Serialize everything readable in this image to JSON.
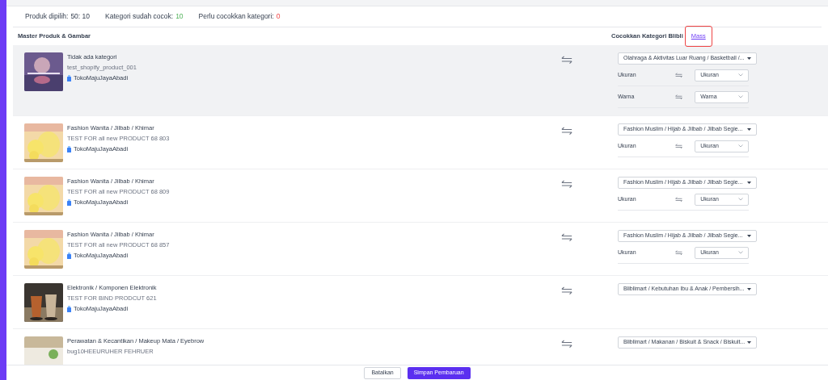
{
  "summary": [
    {
      "label": "Produk dipilih:",
      "value": "50: 10",
      "kind": "total"
    },
    {
      "label": "Kategori sudah cocok:",
      "value": "10",
      "kind": "ok"
    },
    {
      "label": "Perlu cocokkan kategori:",
      "value": "0",
      "kind": "error"
    }
  ],
  "columns": {
    "product": "Master Produk & Gambar",
    "category": "Cocokkan Kategori Blibli",
    "mass_link": "Mass"
  },
  "rows": [
    {
      "selected": true,
      "category": "Tidak ada kategori",
      "name": "test_shopify_product_001",
      "store": "TokoMajuJayaAbadi",
      "target": "Olahraga & Aktivitas Luar Ruang / Basketball /...",
      "attributes": [
        {
          "label": "Ukuran",
          "value": "Ukuran"
        },
        {
          "label": "Warna",
          "value": "Warna"
        }
      ]
    },
    {
      "selected": false,
      "category": "Fashion Wanita / Jilbab / Khimar",
      "name": "TEST FOR all new PRODUCT 68 803",
      "store": "TokoMajuJayaAbadi",
      "target": "Fashion Muslim / Hijab & Jilbab / Jilbab Segie...",
      "attributes": [
        {
          "label": "Ukuran",
          "value": "Ukuran"
        }
      ]
    },
    {
      "selected": false,
      "category": "Fashion Wanita / Jilbab / Khimar",
      "name": "TEST FOR all new PRODUCT 68 809",
      "store": "TokoMajuJayaAbadi",
      "target": "Fashion Muslim / Hijab & Jilbab / Jilbab Segie...",
      "attributes": [
        {
          "label": "Ukuran",
          "value": "Ukuran"
        }
      ]
    },
    {
      "selected": false,
      "category": "Fashion Wanita / Jilbab / Khimar",
      "name": "TEST FOR all new PRODUCT 68 857",
      "store": "TokoMajuJayaAbadi",
      "target": "Fashion Muslim / Hijab & Jilbab / Jilbab Segie...",
      "attributes": [
        {
          "label": "Ukuran",
          "value": "Ukuran"
        }
      ]
    },
    {
      "selected": false,
      "category": "Elektronik / Komponen Elektronik",
      "name": "TEST FOR BIND PRODCUT 621",
      "store": "TokoMajuJayaAbadi",
      "target": "Bliblimart / Kebutuhan Ibu & Anak / Pembersih...",
      "attributes": []
    },
    {
      "selected": false,
      "category": "Perawatan & Kecantikan / Makeup Mata / Eyebrow",
      "name": "bug10HEEURUHER FEHRUER",
      "target": "Bliblimart / Makanan / Biskuit & Snack / Biskuit...",
      "attributes": []
    }
  ],
  "footer": {
    "cancel": "Batalkan",
    "save": "Simpan Pembaruan"
  }
}
